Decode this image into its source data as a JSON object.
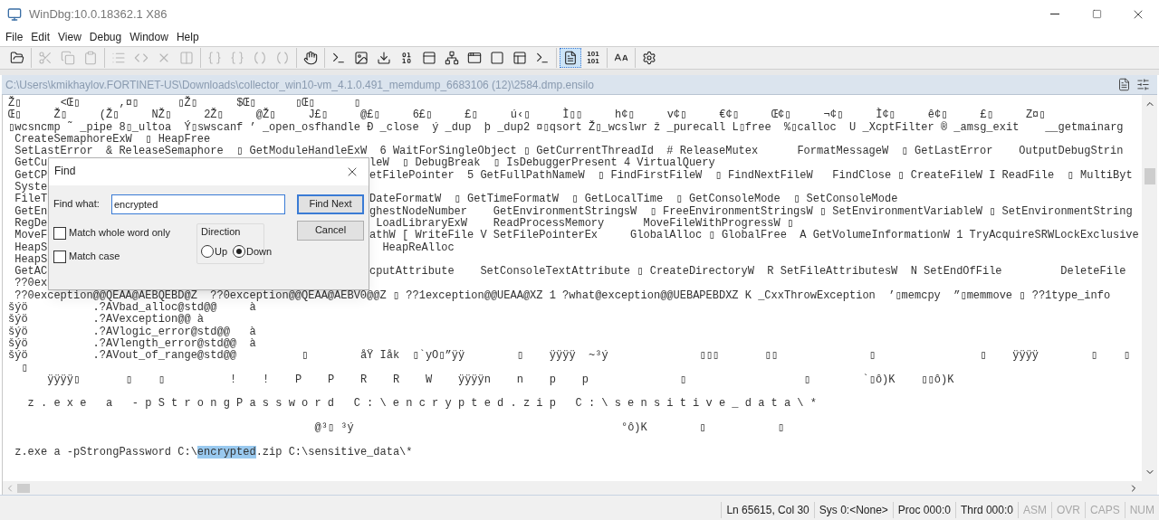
{
  "window": {
    "title": "WinDbg:10.0.18362.1 X86"
  },
  "menu": [
    "File",
    "Edit",
    "View",
    "Debug",
    "Window",
    "Help"
  ],
  "toolbar": [
    [
      {
        "kind": "folder",
        "disabled": false,
        "selected": false
      }
    ],
    [
      {
        "kind": "scissors",
        "disabled": true,
        "selected": false
      },
      {
        "kind": "copy",
        "disabled": true,
        "selected": false
      },
      {
        "kind": "clipboard",
        "disabled": true,
        "selected": false
      }
    ],
    [
      {
        "kind": "list",
        "disabled": true,
        "selected": false
      },
      {
        "kind": "code",
        "disabled": true,
        "selected": false
      },
      {
        "kind": "x",
        "disabled": true,
        "selected": false
      },
      {
        "kind": "columns",
        "disabled": true,
        "selected": false
      }
    ],
    [
      {
        "kind": "braces",
        "disabled": true,
        "selected": false
      },
      {
        "kind": "braces",
        "disabled": true,
        "selected": false
      },
      {
        "kind": "parens",
        "disabled": true,
        "selected": false
      },
      {
        "kind": "parens",
        "disabled": true,
        "selected": false
      }
    ],
    [
      {
        "kind": "hand",
        "disabled": false,
        "selected": false
      }
    ],
    [
      {
        "kind": "terminal",
        "disabled": false,
        "selected": false
      },
      {
        "kind": "image",
        "disabled": false,
        "selected": false
      },
      {
        "kind": "download",
        "disabled": false,
        "selected": false
      },
      {
        "kind": "binary",
        "disabled": false,
        "selected": false
      },
      {
        "kind": "panel",
        "disabled": false,
        "selected": false
      },
      {
        "kind": "network",
        "disabled": false,
        "selected": false
      },
      {
        "kind": "window",
        "disabled": false,
        "selected": false
      },
      {
        "kind": "square",
        "disabled": false,
        "selected": false
      },
      {
        "kind": "panels",
        "disabled": false,
        "selected": false
      },
      {
        "kind": "terminal",
        "disabled": false,
        "selected": false
      }
    ],
    [
      {
        "kind": "file-text",
        "disabled": false,
        "selected": true
      },
      {
        "kind": "label",
        "label": "101 101",
        "disabled": false,
        "selected": false
      }
    ],
    [
      {
        "kind": "font",
        "disabled": false,
        "selected": false
      }
    ],
    [
      {
        "kind": "settings",
        "disabled": false,
        "selected": false
      }
    ]
  ],
  "document": {
    "path": "C:\\Users\\kmikhaylov.FORTINET-US\\Downloads\\collector_win10-vm_4.1.0.491_memdump_6683106 (12)\\2584.dmp.ensilo",
    "lines": [
      {
        "text": "Ž▯      <Œ▯      ,¤▯      ▯Ž▯      $Œ▯      ▯Œ▯      ▯"
      },
      {
        "text": "Œ▯     Ž▯     (Ž▯     NŽ▯     2Ž▯     @Ž▯     J£▯     @£▯     6£▯     £▯     ú‹▯     Ì▯▯     h¢▯     v¢▯     €¢▯     Œ¢▯     ¬¢▯     Ì¢▯     ê¢▯     £▯     Z¤▯"
      },
      {
        "text": "▯wcsncmp ˜ _pipe 8▯_ultoa  Ý▯swscanf ’ _open_osfhandle Ð _close  ý _dup  þ _dup2 ¤▯qsort Ž▯_wcslwr ž _purecall L▯free  %▯calloc  U _XcptFilter ® _amsg_exit    __getmainarg"
      },
      {
        "text": " CreateSemaphoreExW  ▯ HeapFree"
      },
      {
        "text": " SetLastError  & ReleaseSemaphore  ▯ GetModuleHandleExW  6 WaitForSingleObject ▯ GetCurrentThreadId  # ReleaseMutex      FormatMessageW  ▯ GetLastError    OutputDebugStrin"
      },
      {
        "left": " GetCu",
        "right": "leW  ▯ DebugBreak  ▯ IsDebuggerPresent 4 VirtualQuery"
      },
      {
        "left": " GetCP",
        "right": "etFilePointer  5 GetFullPathNameW  ▯ FindFirstFileW  ▯ FindNextFileW   FindClose ▯ CreateFileW I ReadFile  ▯ MultiByt"
      },
      {
        "left": " Syste"
      },
      {
        "left": " FileT",
        "right": "DateFormatW  ▯ GetTimeFormatW  ▯ GetLocalTime  ▯ GetConsoleMode  ▯ SetConsoleMode"
      },
      {
        "left": " GetEn",
        "right": "ghestNodeNumber    GetEnvironmentStringsW  ▯ FreeEnvironmentStringsW ▯ SetEnvironmentVariableW ▯ SetEnvironmentString"
      },
      {
        "left": " RegDe",
        "right": " LoadLibraryExW    ReadProcessMemory      MoveFileWithProgressW ▯"
      },
      {
        "left": " MoveF",
        "right": "athW [ WriteFile V SetFilePointerEx     GlobalAlloc ▯ GlobalFree  A GetVolumeInformationW 1 TryAcquireSRWLockExclusive"
      },
      {
        "left": " HeapS",
        "right": "  HeapReAlloc"
      },
      {
        "left": " HeapS"
      },
      {
        "left": " GetAC",
        "right": "cputAttribute    SetConsoleTextAttribute ▯ CreateDirectoryW  R SetFileAttributesW  N SetEndOfFile         DeleteFile"
      },
      {
        "left": " ??0ex"
      },
      {
        "text": " ??0exception@@QEAA@AEBQEBD@Z  ??0exception@@QEAA@AEBV0@@Z ▯ ??1exception@@UEAA@XZ 1 ?what@exception@@UEBAPEBDXZ K _CxxThrowException  ’▯memcpy  ”▯memmove ▯ ??1type_info"
      },
      {
        "text": "šýö          .?AVbad_alloc@std@@     à"
      },
      {
        "text": "šýö          .?AVexception@@ à"
      },
      {
        "text": "šýö          .?AVlogic_error@std@@   à"
      },
      {
        "text": "šýö          .?AVlength_error@std@@  à"
      },
      {
        "text": "šýö          .?AVout_of_range@std@@          ▯        åŸ Iåk  ▯`yO▯”ÿÿ        ▯    ÿÿÿÿ  ~³ý              ▯▯▯       ▯▯              ▯                ▯    ÿÿÿÿ        ▯    ▯"
      },
      {
        "text": "  ▯"
      },
      {
        "text": "      ÿÿÿÿ▯       ▯    ▯          !    !    P    P    R    R    W    ÿÿÿÿn    n    p    p              ▯                  ▯        `▯ô)K    ▯▯ô)K"
      },
      {
        "blank_line_before": true,
        "text": "   z . e x e   a   - p S t r o n g P a s s w o r d   C : \\ e n c r y p t e d . z i p   C : \\ s e n s i t i v e _ d a t a \\ *"
      },
      {
        "blank_line_before": true,
        "text": "                                               @³▯ ³ý                                         °ô)K        ▯           ▯"
      },
      {
        "blank_line_before": true,
        "before": " z.exe a -pStrongPassword C:\\",
        "selection": "encrypted",
        "after": ".zip C:\\sensitive_data\\*"
      }
    ]
  },
  "find_dialog": {
    "title": "Find",
    "find_what_label": "Find what:",
    "find_what_value": "encrypted",
    "options": [
      {
        "label": "Match whole word only",
        "checked": false
      },
      {
        "label": "Match case",
        "checked": false
      }
    ],
    "direction": {
      "label": "Direction",
      "choices": [
        {
          "label": "Up",
          "selected": false
        },
        {
          "label": "Down",
          "selected": true
        }
      ]
    },
    "buttons": [
      {
        "label": "Find Next",
        "default": true
      },
      {
        "label": "Cancel",
        "default": false
      }
    ]
  },
  "status_bar": [
    {
      "text": "Ln 65615, Col 30",
      "on": true
    },
    {
      "text": "Sys 0:<None>",
      "on": true
    },
    {
      "text": "Proc 000:0",
      "on": true
    },
    {
      "text": "Thrd 000:0",
      "on": true
    },
    {
      "text": "ASM",
      "on": false
    },
    {
      "text": "OVR",
      "on": false
    },
    {
      "text": "CAPS",
      "on": false
    },
    {
      "text": "NUM",
      "on": false
    }
  ]
}
